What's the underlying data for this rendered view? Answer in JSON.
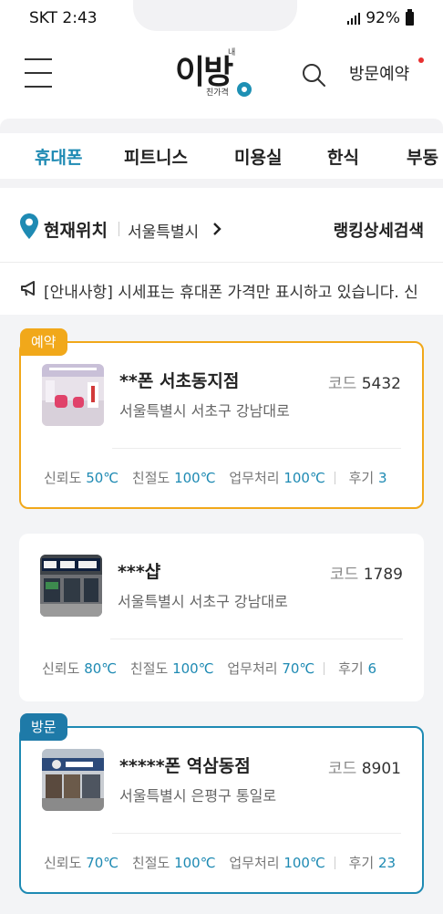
{
  "status_bar": {
    "time": "SKT 2:43",
    "battery": "92%"
  },
  "header": {
    "logo_main": "이방",
    "logo_small_top": "내",
    "logo_sub": "친가격",
    "visit_reservation": "방문예약"
  },
  "tabs": [
    {
      "label": "휴대폰",
      "active": true
    },
    {
      "label": "피트니스",
      "active": false
    },
    {
      "label": "미용실",
      "active": false
    },
    {
      "label": "한식",
      "active": false
    },
    {
      "label": "부동",
      "active": false
    }
  ],
  "location": {
    "label": "현재위치",
    "city": "서울특별시",
    "ranking_search": "랭킹상세검색"
  },
  "notice": {
    "text": "[안내사항] 시세표는 휴대폰 가격만 표시하고 있습니다. 신"
  },
  "stores": [
    {
      "badge": "예약",
      "name": "**폰 서초동지점",
      "address": "서울특별시 서초구 강남대로",
      "code_label": "코드",
      "code": "5432",
      "trust_label": "신뢰도",
      "trust": "50℃",
      "kind_label": "친절도",
      "kind": "100℃",
      "work_label": "업무처리",
      "work": "100℃",
      "review_label": "후기",
      "review": "3"
    },
    {
      "badge": "",
      "name": "***샵",
      "address": "서울특별시 서초구 강남대로",
      "code_label": "코드",
      "code": "1789",
      "trust_label": "신뢰도",
      "trust": "80℃",
      "kind_label": "친절도",
      "kind": "100℃",
      "work_label": "업무처리",
      "work": "70℃",
      "review_label": "후기",
      "review": "6"
    },
    {
      "badge": "방문",
      "name": "*****폰 역삼동점",
      "address": "서울특별시 은평구 통일로",
      "code_label": "코드",
      "code": "8901",
      "trust_label": "신뢰도",
      "trust": "70℃",
      "kind_label": "친절도",
      "kind": "100℃",
      "work_label": "업무처리",
      "work": "100℃",
      "review_label": "후기",
      "review": "23"
    }
  ],
  "colors": {
    "accent": "#1e8ab3",
    "reserve": "#f1a81a",
    "visit": "#1e7aa8",
    "notification": "#e83030"
  }
}
